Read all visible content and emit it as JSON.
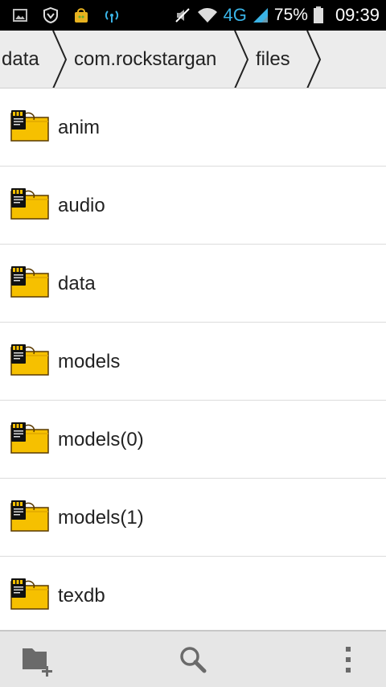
{
  "status_bar": {
    "battery": "75%",
    "network": "4G",
    "time": "09:39",
    "icons": [
      "gallery-icon",
      "shield-icon",
      "shopping-bag-icon",
      "wireless-icon",
      "mute-icon",
      "wifi-icon",
      "signal-icon",
      "battery-icon"
    ]
  },
  "breadcrumb": {
    "items": [
      "data",
      "com.rockstargan",
      "files"
    ]
  },
  "files": [
    {
      "name": "anim"
    },
    {
      "name": "audio"
    },
    {
      "name": "data"
    },
    {
      "name": "models"
    },
    {
      "name": "models(0)"
    },
    {
      "name": "models(1)"
    },
    {
      "name": "texdb"
    }
  ],
  "toolbar": {
    "buttons": [
      "new-folder-icon",
      "search-icon",
      "overflow-menu-icon"
    ]
  },
  "colors": {
    "folder_fill": "#f6c000",
    "folder_stroke": "#5a3a00",
    "network_color": "#3ab3e6"
  }
}
